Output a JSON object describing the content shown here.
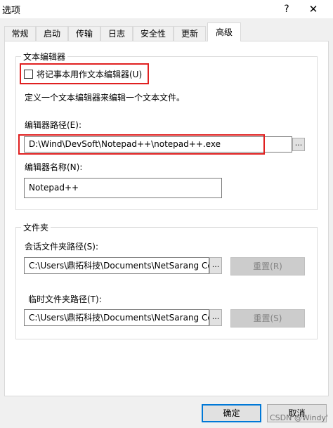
{
  "window": {
    "title": "选项",
    "help_label": "?",
    "close_label": "✕"
  },
  "tabs": [
    {
      "label": "常规"
    },
    {
      "label": "启动"
    },
    {
      "label": "传输"
    },
    {
      "label": "日志"
    },
    {
      "label": "安全性"
    },
    {
      "label": "更新"
    },
    {
      "label": "高级",
      "active": true
    }
  ],
  "text_editor": {
    "group_title": "文本编辑器",
    "checkbox_label": "将记事本用作文本编辑器(U)",
    "checkbox_checked": false,
    "description": "定义一个文本编辑器来编辑一个文本文件。",
    "path_label": "编辑器路径(E):",
    "path_value": "D:\\Wind\\DevSoft\\Notepad++\\notepad++.exe",
    "browse_label": "...",
    "name_label": "编辑器名称(N):",
    "name_value": "Notepad++"
  },
  "folders": {
    "group_title": "文件夹",
    "session_label": "会话文件夹路径(S):",
    "session_value": "C:\\Users\\鼎拓科技\\Documents\\NetSarang Co",
    "session_browse": "...",
    "session_reset": "重置(R)",
    "temp_label": "临时文件夹路径(T):",
    "temp_value": "C:\\Users\\鼎拓科技\\Documents\\NetSarang Co",
    "temp_browse": "...",
    "temp_reset": "重置(S)"
  },
  "footer": {
    "ok_label": "确定",
    "cancel_label": "取消"
  },
  "watermark": "CSDN @Windy'",
  "colors": {
    "highlight": "#e02020",
    "accent": "#0078d7",
    "disabled_button": "#cccccc"
  }
}
